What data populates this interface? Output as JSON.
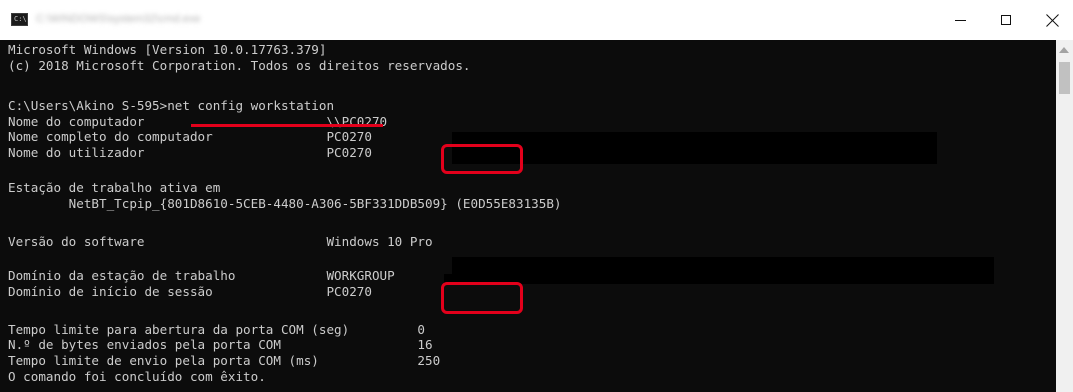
{
  "window": {
    "title": "C:\\WINDOWS\\system32\\cmd.exe",
    "icon": "cmd-icon",
    "icon_text": "C:\\",
    "minimize_icon": "minimize-icon",
    "maximize_icon": "maximize-icon",
    "close_icon": "close-icon"
  },
  "console": {
    "lines": [
      "Microsoft Windows [Version 10.0.17763.379]",
      "(c) 2018 Microsoft Corporation. Todos os direitos reservados.",
      "",
      "C:\\Users\\Akino S-595>net config workstation",
      "Nome do computador                        \\\\PC0270",
      "Nome completo do computador               PC0270",
      "Nome do utilizador                        PC0270",
      "",
      "Estação de trabalho ativa em",
      "        NetBT_Tcpip_{801D8610-5CEB-4480-A306-5BF331DDB509} (E0D55E83135B)",
      "",
      "Versão do software                        Windows 10 Pro",
      "",
      "Domínio da estação de trabalho            WORKGROUP",
      "Domínio de início de sessão               PC0270",
      "",
      "Tempo limite para abertura da porta COM (seg)         0",
      "N.º de bytes enviados pela porta COM                  16",
      "Tempo limite de envio pela porta COM (ms)             250",
      "O comando foi concluído com êxito."
    ]
  },
  "annotation_color": "#e3001b",
  "console_bg": "#0c0c0c",
  "console_fg": "#cccccc"
}
